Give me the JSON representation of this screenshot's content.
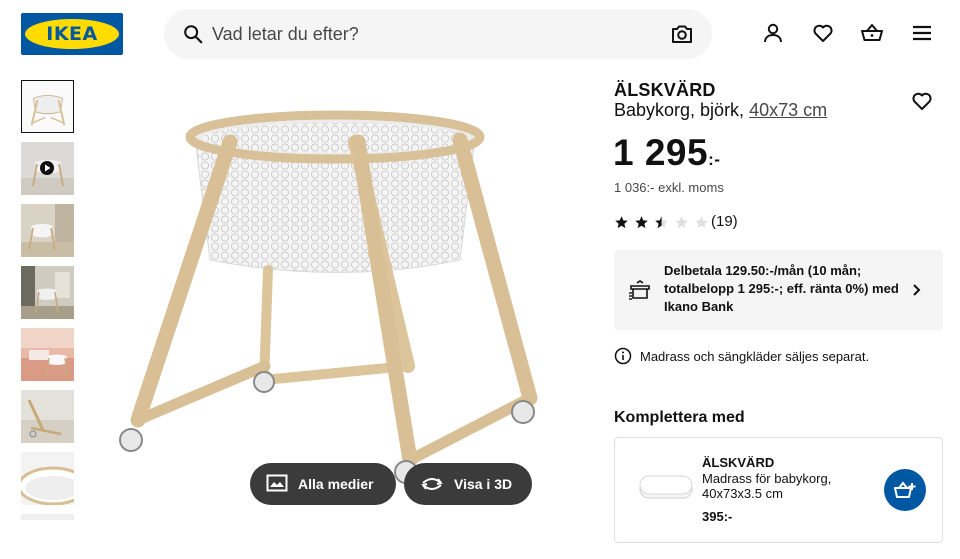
{
  "header": {
    "logo_text": "IKEA",
    "search_placeholder": "Vad letar du efter?",
    "icons": [
      "search-icon",
      "camera-icon",
      "user-icon",
      "heart-icon",
      "basket-icon",
      "menu-icon"
    ]
  },
  "gallery": {
    "thumbnail_count": 7,
    "media_buttons": {
      "all_media": "Alla medier",
      "view_3d": "Visa i 3D"
    }
  },
  "product": {
    "name": "ÄLSKVÄRD",
    "description": "Babykorg, björk,",
    "size_link": "40x73 cm",
    "price_main": "1 295",
    "price_suffix": ":-",
    "price_ex_vat": "1 036:- exkl. moms",
    "rating": 2.5,
    "rating_max": 5,
    "review_count": "(19)",
    "finance_text": "Delbetala 129.50:-/mån (10 mån; totalbelopp 1 295:-; eff. ränta 0%) med Ikano Bank",
    "info_note": "Madrass och sängkläder säljes separat."
  },
  "complement": {
    "heading": "Komplettera med",
    "item": {
      "name": "ÄLSKVÄRD",
      "description": "Madrass för babykorg, 40x73x3.5 cm",
      "price": "395:-"
    }
  },
  "colors": {
    "brand_blue": "#0058a3",
    "brand_yellow": "#ffdb00",
    "media_button_bg": "#3b3b3b",
    "panel_bg": "#f5f5f5"
  }
}
